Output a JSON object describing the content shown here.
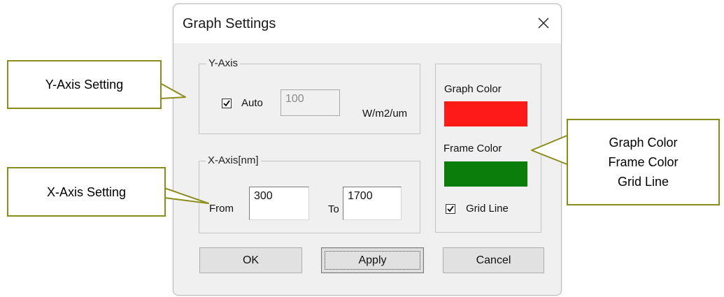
{
  "dialog": {
    "title": "Graph Settings",
    "close_icon": "close-icon"
  },
  "y_axis": {
    "group_label": "Y-Axis",
    "auto_checked": true,
    "auto_label": "Auto",
    "value": "100",
    "unit": "W/m2/um"
  },
  "x_axis": {
    "group_label": "X-Axis[nm]",
    "from_label": "From",
    "from_value": "300",
    "to_label": "To",
    "to_value": "1700"
  },
  "colors": {
    "graph_color_label": "Graph Color",
    "graph_color": "#ff1a1a",
    "frame_color_label": "Frame Color",
    "frame_color": "#0a7d0a",
    "grid_line_checked": true,
    "grid_line_label": "Grid Line"
  },
  "buttons": {
    "ok": "OK",
    "apply": "Apply",
    "cancel": "Cancel"
  },
  "callouts": {
    "y_axis": "Y-Axis Setting",
    "x_axis": "X-Axis Setting",
    "colors": [
      "Graph Color",
      "Frame Color",
      "Grid Line"
    ],
    "border_color": "#8b8c1c"
  }
}
